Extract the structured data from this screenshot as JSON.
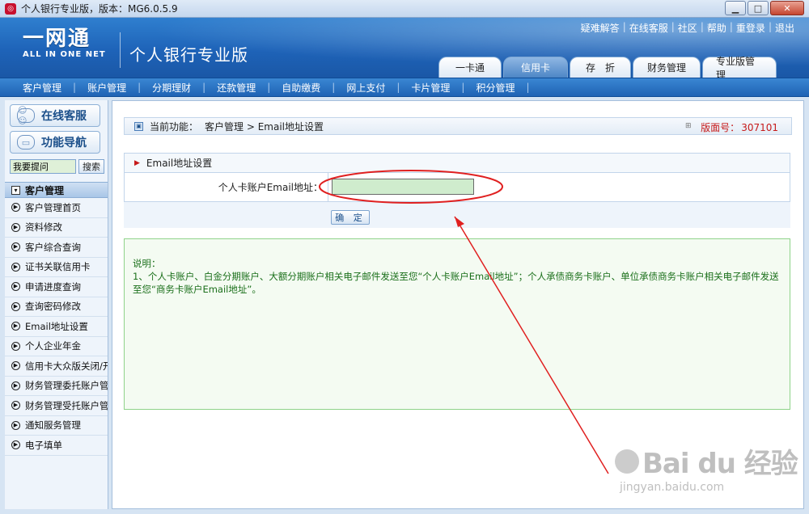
{
  "window": {
    "title": "个人银行专业版，版本：MG6.0.5.9",
    "app_icon": "bank-app-icon",
    "controls": [
      "minimize",
      "maximize",
      "close"
    ]
  },
  "header": {
    "logo_main": "一网通",
    "logo_sub": "ALL IN ONE NET",
    "product_title": "个人银行专业版",
    "top_links": [
      "疑难解答",
      "在线客服",
      "社区",
      "帮助",
      "重登录",
      "退出"
    ],
    "tabs": [
      {
        "label": "一卡通",
        "active": false
      },
      {
        "label": "信用卡",
        "active": true
      },
      {
        "label": "存　折",
        "active": false
      },
      {
        "label": "财务管理",
        "active": false
      },
      {
        "label": "专业版管理",
        "active": false
      }
    ]
  },
  "menu": {
    "items": [
      "客户管理",
      "账户管理",
      "分期理财",
      "还款管理",
      "自助缴费",
      "网上支付",
      "卡片管理",
      "积分管理"
    ]
  },
  "sidebar": {
    "online_service": "在线客服",
    "function_nav": "功能导航",
    "search_value": "我要提问",
    "search_button": "搜索",
    "section_title": "客户管理",
    "items": [
      "客户管理首页",
      "资料修改",
      "客户综合查询",
      "证书关联信用卡",
      "申请进度查询",
      "查询密码修改",
      "Email地址设置",
      "个人企业年金",
      "信用卡大众版关闭/开",
      "财务管理委托账户管理",
      "财务管理受托账户管理",
      "通知服务管理",
      "电子填单"
    ]
  },
  "main": {
    "crumb_label": "当前功能：",
    "crumb_path": "客户管理 > Email地址设置",
    "page_no_label": "版面号：",
    "page_no": "307101",
    "panel_title": "Email地址设置",
    "field_label": "个人卡账户Email地址：",
    "email_value": "",
    "confirm_label": "确 定",
    "note_title": "说明：",
    "note_text": "1、个人卡账户、白金分期账户、大额分期账户相关电子邮件发送至您“个人卡账户Email地址”；个人承债商务卡账户、单位承债商务卡账户相关电子邮件发送至您“商务卡账户Email地址”。"
  },
  "annotation": {
    "color": "#e02020"
  },
  "watermark": {
    "brand": "Bai du 经验",
    "url": "jingyan.baidu.com"
  }
}
